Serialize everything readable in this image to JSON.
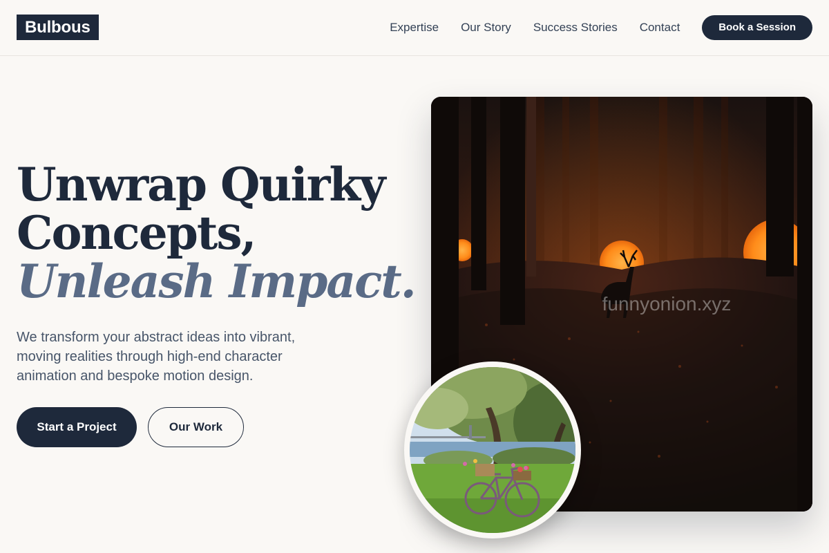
{
  "header": {
    "logo": "Bulbous",
    "nav": [
      "Expertise",
      "Our Story",
      "Success Stories",
      "Contact"
    ],
    "cta": "Book a Session"
  },
  "hero": {
    "headline_line1": "Unwrap Quirky",
    "headline_line2": "Concepts,",
    "headline_accent": "Unleash Impact.",
    "subtext": "We transform your abstract ideas into vibrant, moving realities through high-end character animation and bespoke motion design.",
    "primary_button": "Start a Project",
    "secondary_button": "Our Work"
  },
  "media": {
    "main_image_watermark": "funnyonion.xyz"
  },
  "colors": {
    "primary": "#1e293b",
    "accent": "#5a6b86",
    "background": "#faf8f5",
    "glow": "#ff9a1f"
  }
}
